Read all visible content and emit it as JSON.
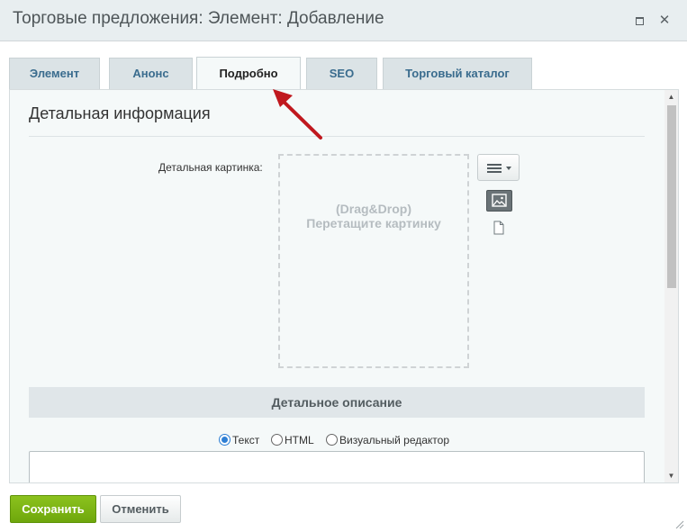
{
  "window": {
    "title": "Торговые предложения: Элемент: Добавление",
    "maximize_icon": "maximize-icon",
    "close_icon": "close-icon",
    "close_glyph": "✕"
  },
  "tabs": [
    {
      "label": "Элемент",
      "active": false
    },
    {
      "label": "Анонс",
      "active": false
    },
    {
      "label": "Подробно",
      "active": true
    },
    {
      "label": "SEO",
      "active": false
    },
    {
      "label": "Торговый каталог",
      "active": false
    }
  ],
  "section": {
    "title": "Детальная информация"
  },
  "detail_picture": {
    "label": "Детальная картинка:",
    "dropzone_line1": "(Drag&Drop)",
    "dropzone_line2": "Перетащите картинку",
    "menu_icon": "hamburger-menu-icon",
    "image_icon": "image-icon",
    "file_icon": "file-icon"
  },
  "description": {
    "header": "Детальное описание",
    "modes": [
      {
        "label": "Текст",
        "checked": true
      },
      {
        "label": "HTML",
        "checked": false
      },
      {
        "label": "Визуальный редактор",
        "checked": false
      }
    ],
    "value": ""
  },
  "footer": {
    "save_label": "Сохранить",
    "cancel_label": "Отменить"
  },
  "colors": {
    "save_green": "#7cb518",
    "annotation_arrow": "#c0181e",
    "tab_link": "#3a6c8e"
  }
}
